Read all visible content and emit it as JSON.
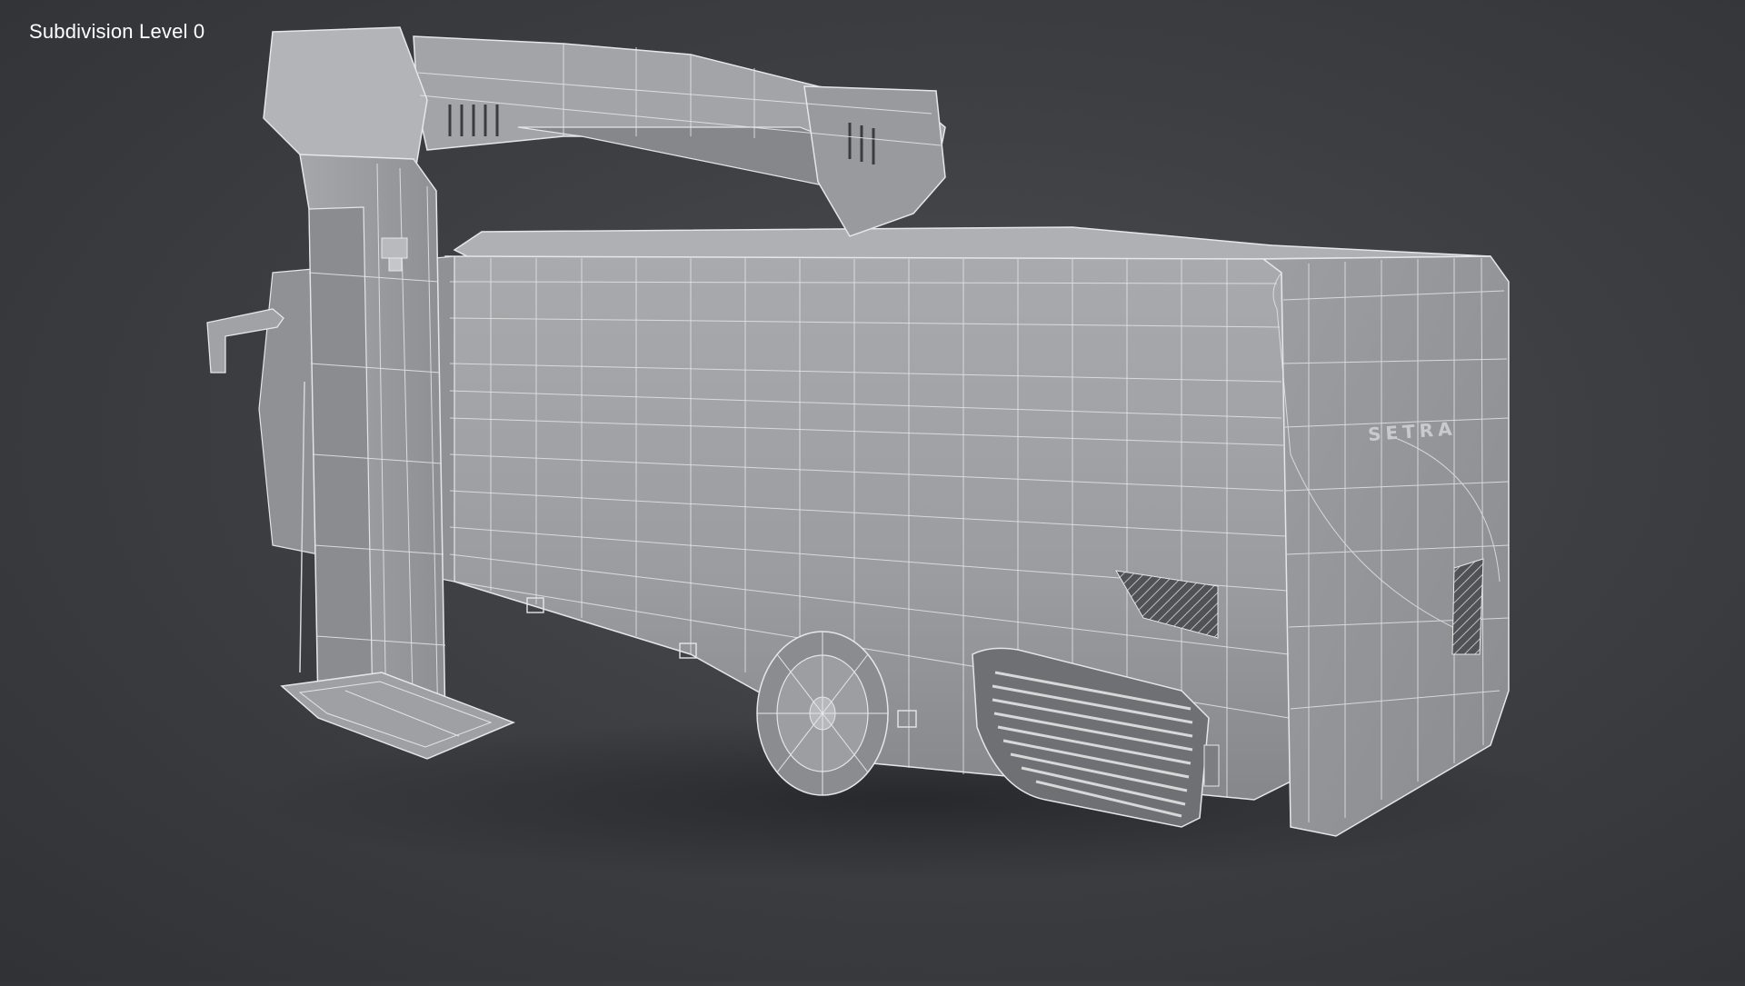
{
  "viewport": {
    "overlay_label": "Subdivision Level 0",
    "bus_brand_text": "SETRA"
  },
  "scene": {
    "objects": [
      "gantry-wash-rig",
      "coach-bus"
    ],
    "render_style": "wireframe-on-shaded",
    "colors": {
      "background": "#3d3f43",
      "model_surface": "#9a9ca0",
      "model_surface_light": "#b2b4b7",
      "model_surface_dark": "#76787c",
      "wireframe": "#e8e8e8"
    }
  }
}
